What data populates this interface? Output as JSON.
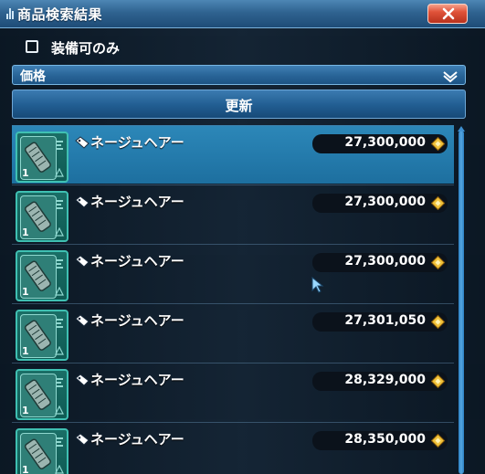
{
  "window": {
    "title": "商品検索結果"
  },
  "filters": {
    "equip_only_label": "装備可のみ",
    "equip_only_checked": false,
    "sort_selected": "価格",
    "refresh_label": "更新"
  },
  "results": [
    {
      "name": "ネージュヘアー",
      "price": "27,300,000",
      "stack": "1",
      "selected": true
    },
    {
      "name": "ネージュヘアー",
      "price": "27,300,000",
      "stack": "1",
      "selected": false
    },
    {
      "name": "ネージュヘアー",
      "price": "27,300,000",
      "stack": "1",
      "selected": false
    },
    {
      "name": "ネージュヘアー",
      "price": "27,301,050",
      "stack": "1",
      "selected": false
    },
    {
      "name": "ネージュヘアー",
      "price": "28,329,000",
      "stack": "1",
      "selected": false
    },
    {
      "name": "ネージュヘアー",
      "price": "28,350,000",
      "stack": "1",
      "selected": false
    }
  ],
  "colors": {
    "title_bar": "#2f6390",
    "selected_row": "#2379aa",
    "item_frame": "#3fc0b2",
    "close_button": "#e0533a",
    "meseta_gold": "#f2c33a"
  },
  "icons": {
    "close": "close-icon",
    "dropdown": "chevron-down-icon",
    "item_tag": "tag-icon",
    "currency": "meseta-icon"
  }
}
